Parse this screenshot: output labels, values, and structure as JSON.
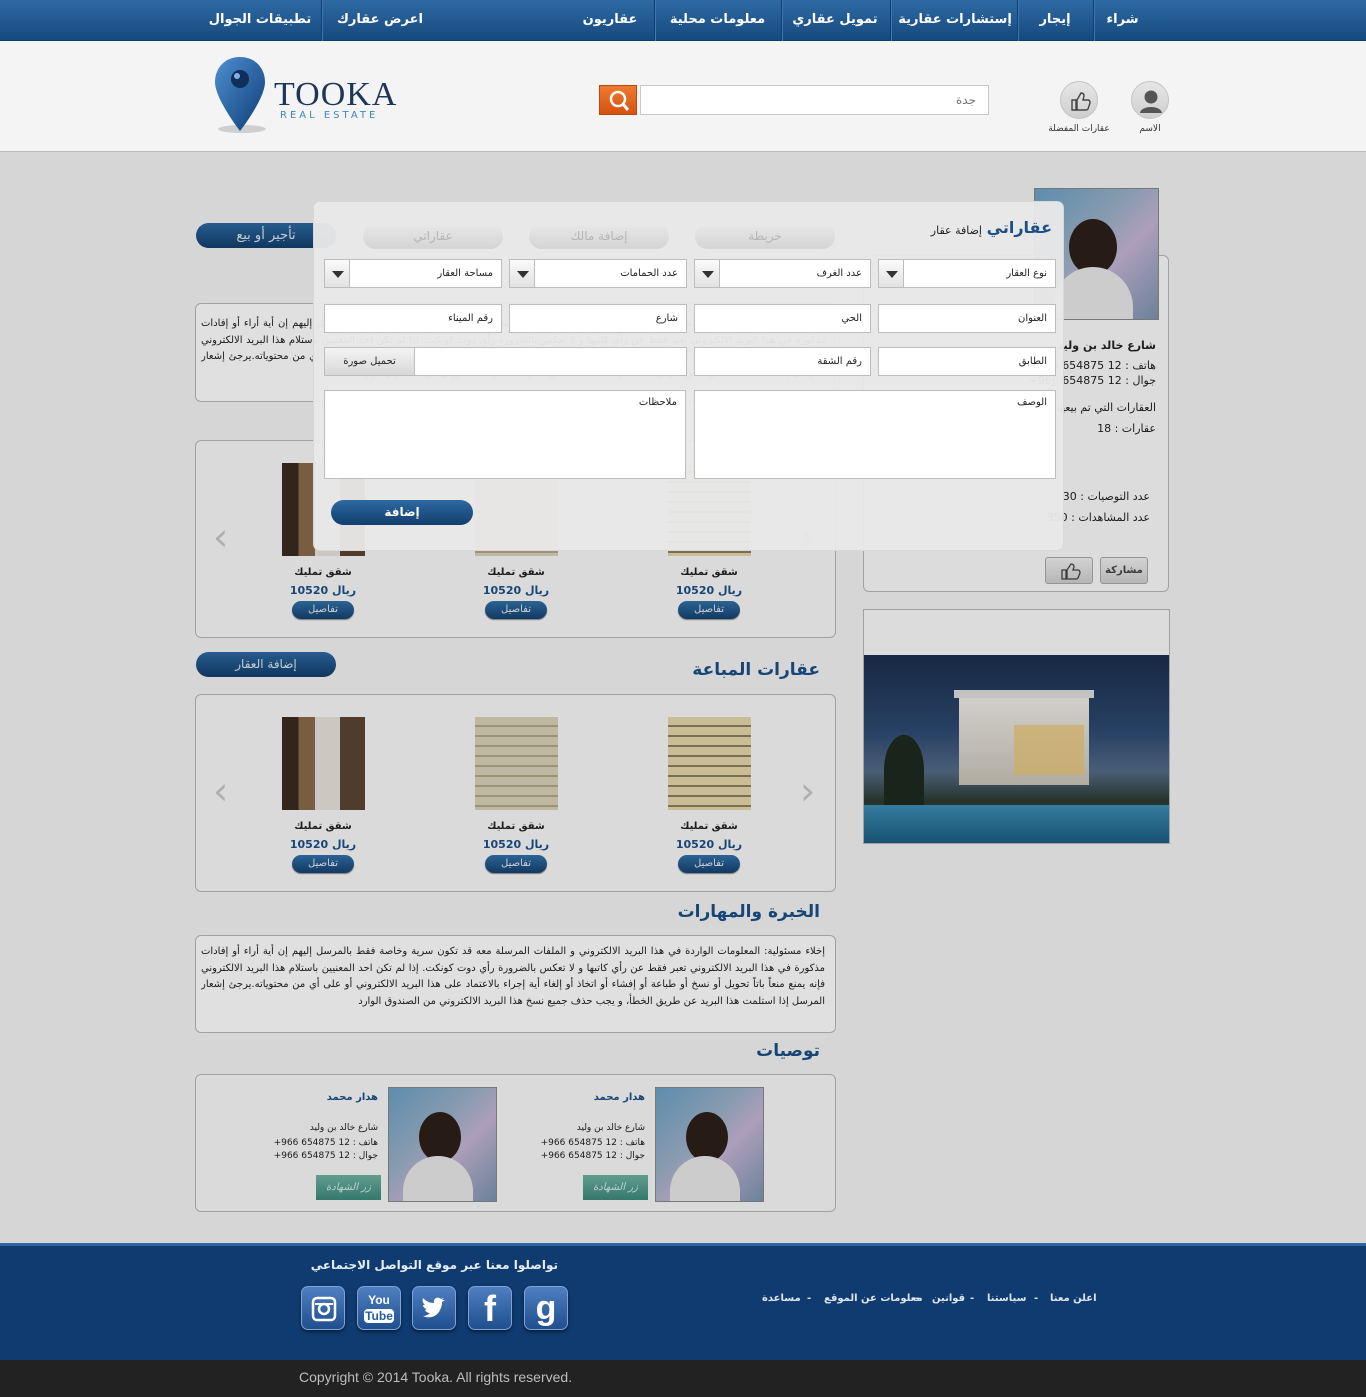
{
  "nav": {
    "items": [
      "شراء",
      "إيجار",
      "إستشارات عقارية",
      "تمويل عقاري",
      "معلومات محلية",
      "عقاريون",
      "اعرض  عقارك",
      "تطبيقات الجوال"
    ]
  },
  "header": {
    "logo_main": "TOOKA",
    "logo_sub": "REAL ESTATE",
    "search_placeholder": "جدة",
    "profile_label": "الاسم",
    "favorites_label": "عقارات المفضلة"
  },
  "profile": {
    "address": "شارع خالد بن وليد",
    "phone": "هاتف : 12 654875 966+",
    "mobile": "جوال : 12 654875 966+",
    "listed_title": "العقارات التي تم بيعها",
    "listed_count": "عقارات  :   18",
    "recommendations": "عدد التوصيات  :  30",
    "views": "عدد المشاهدات : 350",
    "share_label": "مشاركة"
  },
  "tabs": [
    "خريطة",
    "إضافة مالك",
    "عقاراتي",
    "تأجير أو بيع"
  ],
  "add_property_button": "إضافة العقار",
  "sold_title": "عقارات المباعة",
  "skills_title": "الخبرة والمهارات",
  "recommendations_title": "توصيات",
  "disclaimer": "إخلاء مسئولية: المعلومات الواردة في هذا البريد الالكتروني و الملفات المرسلة معه قد تكون سرية وخاصة فقط بالمرسل إليهم إن أية أراء أو إفادات مذكورة في هذا البريد الالكتروني تعبر فقط عن رأي كاتبها و لا تعكس بالضرورة رأي دوت كونكت. إذا لم تكن احد المعنيين باستلام هذا البريد الالكتروني فإنه يمنع منعاً باتاً تحويل أو نسخ أو طباعة أو إفشاء أو اتخاذ أو إلغاء أية إجراء بالاعتماد على هذا البريد الالكتروني أو على أي من محتوياته.يرجئ إشعار المرسل إذا استلمت هذا البريد عن طريق الخطأ، و يجب حذف جميع نسخ هذا البريد الالكتروني من الصندوق الوارد",
  "properties": [
    {
      "title": "شقق تمليك",
      "price": "10520 ريال",
      "details": "تفاصيل"
    },
    {
      "title": "شقق تمليك",
      "price": "10520 ريال",
      "details": "تفاصيل"
    },
    {
      "title": "شقق تمليك",
      "price": "10520 ريال",
      "details": "تفاصيل"
    }
  ],
  "recommenders": [
    {
      "name": "هدار محمد",
      "address": "شارع خالد بن وليد",
      "phone": "هاتف : 12 654875 966+",
      "mobile": "جوال : 12 654875 966+",
      "visit": "زر الشهادة"
    },
    {
      "name": "هدار محمد",
      "address": "شارع خالد بن وليد",
      "phone": "هاتف : 12 654875 966+",
      "mobile": "جوال : 12 654875 966+",
      "visit": "زر الشهادة"
    }
  ],
  "modal": {
    "title": "عقاراتي",
    "subtitle": "إضافة عقار",
    "tabs": [
      "خريطة",
      "إضافة مالك",
      "عقاراتي"
    ],
    "type_select": "نوع العقار",
    "rooms_select": "عدد الغرف",
    "baths_select": "عدد الحمامات",
    "area_select": "مساحة العقار",
    "address": "العنوان",
    "district": "الحي",
    "street": "شارع",
    "postal": "رقم الميناء",
    "floor": "الطابق",
    "apartment": "رقم الشقة",
    "upload": "تحميل صورة",
    "description": "الوصف",
    "notes": "ملاحظات",
    "submit": "إضافة"
  },
  "footer": {
    "social_title": "تواصلوا معنا عبر موقع التواصل الاجتماعي",
    "links": [
      "اعلن معنا",
      "سياستنا",
      "قوانين",
      "معلومات عن الموقع",
      "مساعدة"
    ],
    "separator": "-",
    "social_icons": [
      "instagram-icon",
      "youtube-icon",
      "twitter-icon",
      "facebook-icon",
      "google-icon"
    ],
    "youtube_you": "You",
    "youtube_tube": "Tube",
    "copyright": "Copyright © 2014 Tooka. All rights reserved."
  }
}
